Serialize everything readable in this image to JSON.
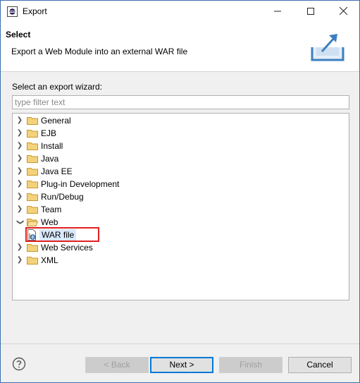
{
  "window": {
    "title": "Export"
  },
  "header": {
    "title": "Select",
    "description": "Export a Web Module into an external WAR file"
  },
  "wizard": {
    "label": "Select an export wizard:",
    "filter_placeholder": "type filter text",
    "filter_value": ""
  },
  "tree": {
    "items": [
      {
        "label": "General",
        "expanded": false
      },
      {
        "label": "EJB",
        "expanded": false
      },
      {
        "label": "Install",
        "expanded": false
      },
      {
        "label": "Java",
        "expanded": false
      },
      {
        "label": "Java EE",
        "expanded": false
      },
      {
        "label": "Plug-in Development",
        "expanded": false
      },
      {
        "label": "Run/Debug",
        "expanded": false
      },
      {
        "label": "Team",
        "expanded": false
      },
      {
        "label": "Web",
        "expanded": true,
        "children": [
          {
            "label": "WAR file",
            "selected": true
          }
        ]
      },
      {
        "label": "Web Services",
        "expanded": false
      },
      {
        "label": "XML",
        "expanded": false
      }
    ]
  },
  "buttons": {
    "back": "< Back",
    "next": "Next >",
    "finish": "Finish",
    "cancel": "Cancel"
  },
  "icons": {
    "app": "eclipse-icon",
    "folder": "folder-icon",
    "war": "war-file-icon",
    "help": "help-icon",
    "header": "export-graphic-icon"
  },
  "colors": {
    "selection": "#d9e8fb",
    "highlight_box": "#e32020",
    "default_button_border": "#0078d7",
    "folder": "#e8b84a"
  }
}
